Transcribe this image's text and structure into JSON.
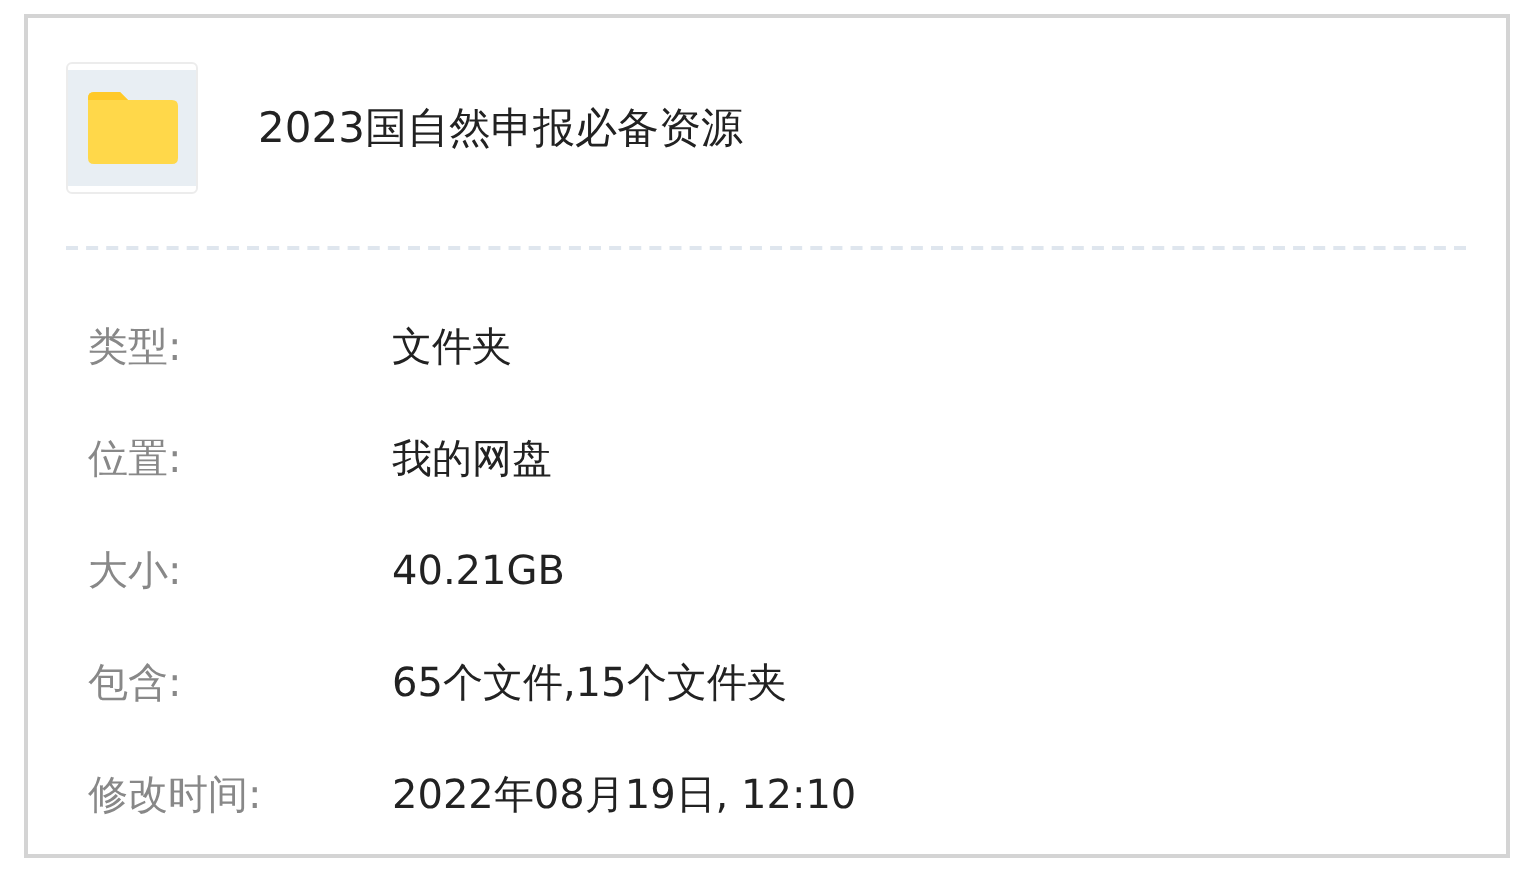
{
  "folder": {
    "name": "2023国自然申报必备资源"
  },
  "properties": [
    {
      "label": "类型:",
      "value": "文件夹"
    },
    {
      "label": "位置:",
      "value": "我的网盘"
    },
    {
      "label": "大小:",
      "value": "40.21GB"
    },
    {
      "label": "包含:",
      "value": "65个文件,15个文件夹"
    },
    {
      "label": "修改时间:",
      "value": "2022年08月19日, 12:10"
    }
  ]
}
